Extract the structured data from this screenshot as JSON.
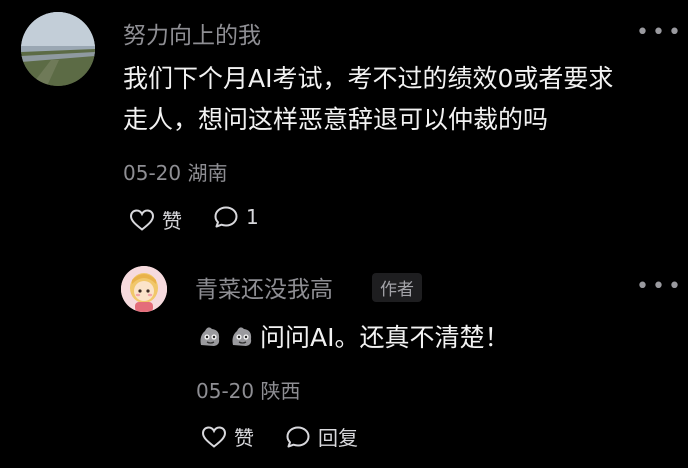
{
  "comment": {
    "username": "努力向上的我",
    "text_line1": "我们下个月AI考试，考不过的绩效0或者要求",
    "text_line2": "走人，想问这样恶意辞退可以仲裁的吗",
    "date": "05-20",
    "location": "湖南",
    "like_label": "赞",
    "reply_count": "1",
    "more_icon": "more-dots-icon"
  },
  "reply": {
    "username": "青菜还没我高",
    "badge": "作者",
    "emoji_count": 2,
    "text": "问问AI。还真不清楚！",
    "date": "05-20",
    "location": "陕西",
    "like_label": "赞",
    "reply_label": "回复"
  },
  "colors": {
    "background": "#000000",
    "text_primary": "#f2f2f2",
    "text_secondary": "#8e8e93"
  }
}
